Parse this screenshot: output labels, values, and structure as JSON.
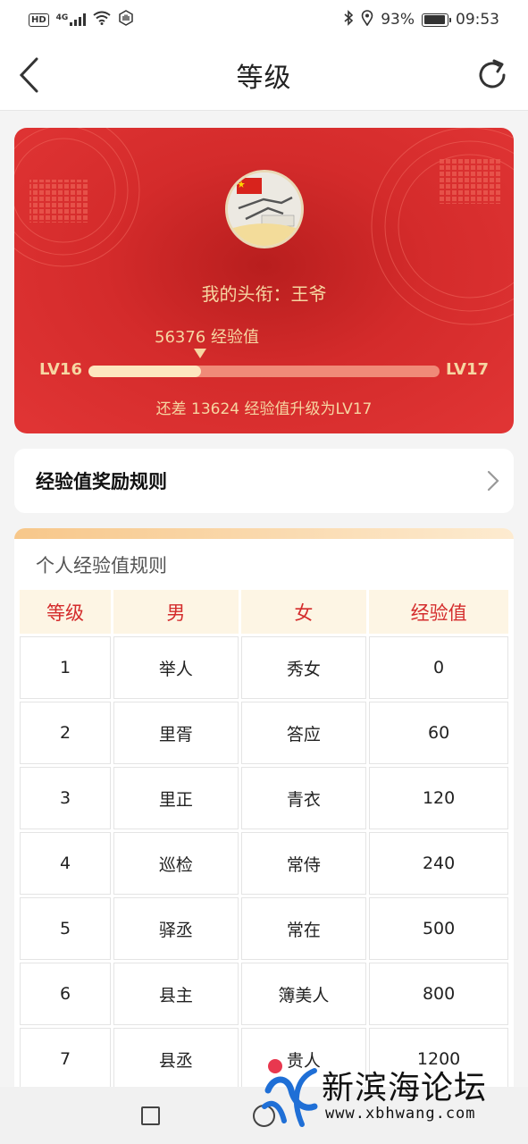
{
  "status_bar": {
    "network_badge": "HD",
    "network_type": "4G",
    "battery_percent": "93%",
    "time": "09:53",
    "battery_level": 0.93
  },
  "nav": {
    "title": "等级",
    "back_icon": "chevron-left-icon",
    "refresh_icon": "refresh-icon"
  },
  "level_card": {
    "title_label": "我的头衔：王爷",
    "current_exp": "56376 经验值",
    "current_level": "LV16",
    "next_level": "LV17",
    "progress": 0.32,
    "remaining_text": "还差 13624 经验值升级为LV17"
  },
  "rules_link": {
    "label": "经验值奖励规则"
  },
  "rules_section": {
    "title": "个人经验值规则",
    "headers": [
      "等级",
      "男",
      "女",
      "经验值"
    ],
    "rows": [
      [
        "1",
        "举人",
        "秀女",
        "0"
      ],
      [
        "2",
        "里胥",
        "答应",
        "60"
      ],
      [
        "3",
        "里正",
        "青衣",
        "120"
      ],
      [
        "4",
        "巡检",
        "常侍",
        "240"
      ],
      [
        "5",
        "驿丞",
        "常在",
        "500"
      ],
      [
        "6",
        "县主",
        "簿美人",
        "800"
      ],
      [
        "7",
        "县丞",
        "贵人",
        "1200"
      ]
    ]
  },
  "watermark": {
    "brand": "新滨海论坛",
    "url": "www.xbhwang.com"
  },
  "colors": {
    "card_red": "#d42b2b",
    "gold_text": "#f6d6a2",
    "header_red": "#d42c2c",
    "header_bg": "#fdf5e4"
  }
}
